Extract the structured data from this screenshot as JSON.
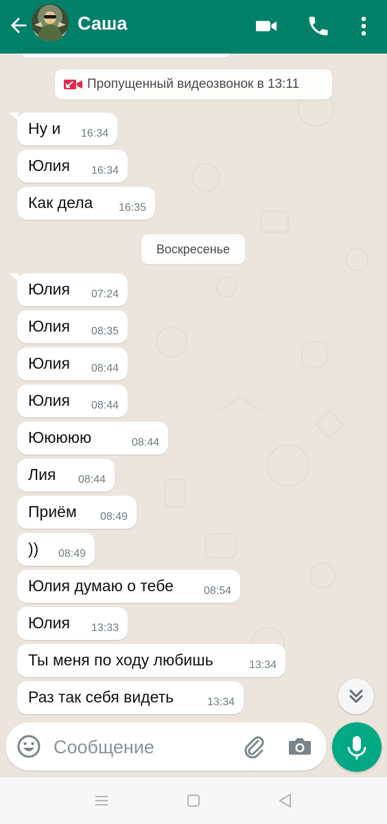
{
  "header": {
    "contact_name": "Саша",
    "icons": {
      "back": "arrow-left-icon",
      "video": "video-camera-icon",
      "call": "phone-icon",
      "menu": "more-vertical-icon"
    }
  },
  "colors": {
    "header": "#008069",
    "chat_background": "#ece5dd",
    "missed_call_icon": "#e02d4f",
    "mic_button": "#00a884",
    "timestamp": "#6f7b80"
  },
  "system_messages": {
    "missed_call": "Пропущенный видеозвонок в 13:11",
    "day_separator": "Воскресенье"
  },
  "messages": [
    {
      "text": "Ну и",
      "time": "16:34"
    },
    {
      "text": "Юлия",
      "time": "16:34"
    },
    {
      "text": "Как дела",
      "time": "16:35"
    },
    {
      "text": "Юлия",
      "time": "07:24"
    },
    {
      "text": "Юлия",
      "time": "08:35"
    },
    {
      "text": "Юлия",
      "time": "08:44"
    },
    {
      "text": "Юлия",
      "time": "08:44"
    },
    {
      "text": "Ююююю",
      "time": "08:44"
    },
    {
      "text": "Лия",
      "time": "08:44"
    },
    {
      "text": "Приём",
      "time": "08:49"
    },
    {
      "text": "))",
      "time": "08:49"
    },
    {
      "text": "Юлия думаю о тебе",
      "time": "08:54"
    },
    {
      "text": "Юлия",
      "time": "13:33"
    },
    {
      "text": "Ты меня по ходу любишь",
      "time": "13:34"
    },
    {
      "text": "Раз так себя видеть",
      "time": "13:34"
    }
  ],
  "composer": {
    "placeholder": "Сообщение",
    "icons": {
      "emoji": "emoji-icon",
      "attach": "paperclip-icon",
      "camera": "camera-icon",
      "mic": "microphone-icon"
    }
  },
  "scroll_button_icon": "chevron-double-down-icon",
  "navbar_icons": [
    "menu-icon",
    "home-icon",
    "back-triangle-icon"
  ]
}
